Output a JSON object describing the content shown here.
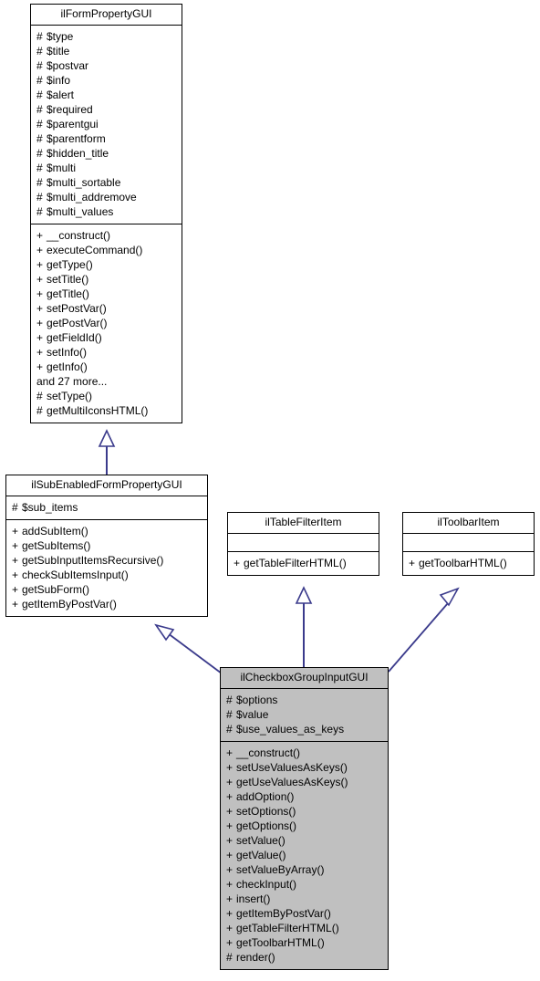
{
  "diagram": {
    "type": "uml-class-diagram",
    "title": "ilCheckboxGroupInputGUI inheritance diagram",
    "line_color": "#3b3b8c",
    "fill_highlight": "#c0c0c0",
    "border_color": "#000000"
  },
  "classes": [
    {
      "id": "ilFormPropertyGUI",
      "name": "ilFormPropertyGUI",
      "highlighted": false,
      "attributes": [
        {
          "vis": "#",
          "name": "$type"
        },
        {
          "vis": "#",
          "name": "$title"
        },
        {
          "vis": "#",
          "name": "$postvar"
        },
        {
          "vis": "#",
          "name": "$info"
        },
        {
          "vis": "#",
          "name": "$alert"
        },
        {
          "vis": "#",
          "name": "$required"
        },
        {
          "vis": "#",
          "name": "$parentgui"
        },
        {
          "vis": "#",
          "name": "$parentform"
        },
        {
          "vis": "#",
          "name": "$hidden_title"
        },
        {
          "vis": "#",
          "name": "$multi"
        },
        {
          "vis": "#",
          "name": "$multi_sortable"
        },
        {
          "vis": "#",
          "name": "$multi_addremove"
        },
        {
          "vis": "#",
          "name": "$multi_values"
        }
      ],
      "operations": [
        {
          "vis": "+",
          "name": "__construct()"
        },
        {
          "vis": "+",
          "name": "executeCommand()"
        },
        {
          "vis": "+",
          "name": "getType()"
        },
        {
          "vis": "+",
          "name": "setTitle()"
        },
        {
          "vis": "+",
          "name": "getTitle()"
        },
        {
          "vis": "+",
          "name": "setPostVar()"
        },
        {
          "vis": "+",
          "name": "getPostVar()"
        },
        {
          "vis": "+",
          "name": "getFieldId()"
        },
        {
          "vis": "+",
          "name": "setInfo()"
        },
        {
          "vis": "+",
          "name": "getInfo()"
        },
        {
          "vis": "",
          "name": "and 27 more..."
        },
        {
          "vis": "#",
          "name": "setType()"
        },
        {
          "vis": "#",
          "name": "getMultiIconsHTML()"
        }
      ]
    },
    {
      "id": "ilSubEnabledFormPropertyGUI",
      "name": "ilSubEnabledFormPropertyGUI",
      "highlighted": false,
      "attributes": [
        {
          "vis": "#",
          "name": "$sub_items"
        }
      ],
      "operations": [
        {
          "vis": "+",
          "name": "addSubItem()"
        },
        {
          "vis": "+",
          "name": "getSubItems()"
        },
        {
          "vis": "+",
          "name": "getSubInputItemsRecursive()"
        },
        {
          "vis": "+",
          "name": "checkSubItemsInput()"
        },
        {
          "vis": "+",
          "name": "getSubForm()"
        },
        {
          "vis": "+",
          "name": "getItemByPostVar()"
        }
      ]
    },
    {
      "id": "ilTableFilterItem",
      "name": "ilTableFilterItem",
      "highlighted": false,
      "attributes": [],
      "operations": [
        {
          "vis": "+",
          "name": "getTableFilterHTML()"
        }
      ]
    },
    {
      "id": "ilToolbarItem",
      "name": "ilToolbarItem",
      "highlighted": false,
      "attributes": [],
      "operations": [
        {
          "vis": "+",
          "name": "getToolbarHTML()"
        }
      ]
    },
    {
      "id": "ilCheckboxGroupInputGUI",
      "name": "ilCheckboxGroupInputGUI",
      "highlighted": true,
      "attributes": [
        {
          "vis": "#",
          "name": "$options"
        },
        {
          "vis": "#",
          "name": "$value"
        },
        {
          "vis": "#",
          "name": "$use_values_as_keys"
        }
      ],
      "operations": [
        {
          "vis": "+",
          "name": "__construct()"
        },
        {
          "vis": "+",
          "name": "setUseValuesAsKeys()"
        },
        {
          "vis": "+",
          "name": "getUseValuesAsKeys()"
        },
        {
          "vis": "+",
          "name": "addOption()"
        },
        {
          "vis": "+",
          "name": "setOptions()"
        },
        {
          "vis": "+",
          "name": "getOptions()"
        },
        {
          "vis": "+",
          "name": "setValue()"
        },
        {
          "vis": "+",
          "name": "getValue()"
        },
        {
          "vis": "+",
          "name": "setValueByArray()"
        },
        {
          "vis": "+",
          "name": "checkInput()"
        },
        {
          "vis": "+",
          "name": "insert()"
        },
        {
          "vis": "+",
          "name": "getItemByPostVar()"
        },
        {
          "vis": "+",
          "name": "getTableFilterHTML()"
        },
        {
          "vis": "+",
          "name": "getToolbarHTML()"
        },
        {
          "vis": "#",
          "name": "render()"
        }
      ]
    }
  ],
  "relations": [
    {
      "from": "ilSubEnabledFormPropertyGUI",
      "to": "ilFormPropertyGUI",
      "kind": "generalization"
    },
    {
      "from": "ilCheckboxGroupInputGUI",
      "to": "ilSubEnabledFormPropertyGUI",
      "kind": "generalization"
    },
    {
      "from": "ilCheckboxGroupInputGUI",
      "to": "ilTableFilterItem",
      "kind": "generalization"
    },
    {
      "from": "ilCheckboxGroupInputGUI",
      "to": "ilToolbarItem",
      "kind": "generalization"
    }
  ]
}
